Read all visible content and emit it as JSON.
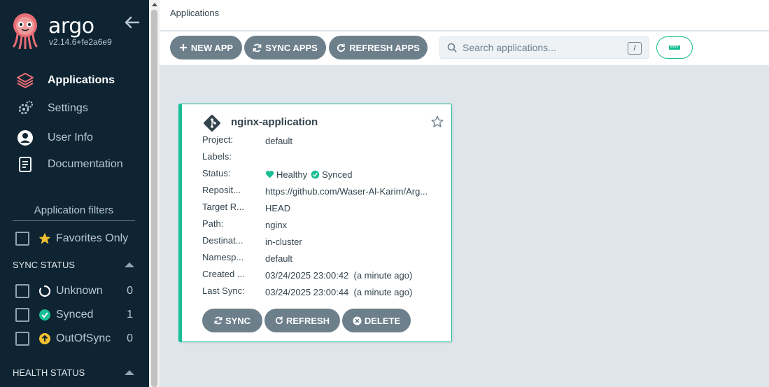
{
  "sidebar": {
    "logo_text": "argo",
    "version": "v2.14.6+fe2a6e9",
    "nav": [
      {
        "label": "Applications",
        "icon": "layers-icon",
        "active": true
      },
      {
        "label": "Settings",
        "icon": "gears-icon"
      },
      {
        "label": "User Info",
        "icon": "user-circle-icon"
      },
      {
        "label": "Documentation",
        "icon": "book-icon"
      }
    ],
    "filters_title": "Application filters",
    "favorites_label": "Favorites Only",
    "sync_status": {
      "title": "SYNC STATUS",
      "items": [
        {
          "label": "Unknown",
          "count": "0",
          "icon": "circle-notch-icon"
        },
        {
          "label": "Synced",
          "count": "1",
          "icon": "check-circle-icon"
        },
        {
          "label": "OutOfSync",
          "count": "0",
          "icon": "arrow-up-circle-icon"
        }
      ]
    },
    "health_status": {
      "title": "HEALTH STATUS"
    }
  },
  "header": {
    "breadcrumb": "Applications"
  },
  "toolbar": {
    "new_app": "NEW APP",
    "sync_apps": "SYNC APPS",
    "refresh_apps": "REFRESH APPS",
    "search_placeholder": "Search applications...",
    "search_shortcut": "/"
  },
  "colors": {
    "accent": "#18be94",
    "sidebar_bg": "#0e2432",
    "button_bg": "#6d7f8b",
    "argo_orange": "#e96d76"
  },
  "app_card": {
    "title": "nginx-application",
    "fields": [
      {
        "key": "Project:",
        "value": "default"
      },
      {
        "key": "Labels:",
        "value": ""
      },
      {
        "key": "Status:",
        "health": "Healthy",
        "sync": "Synced"
      },
      {
        "key": "Reposit...",
        "value": "https://github.com/Waser-Al-Karim/Arg..."
      },
      {
        "key": "Target R...",
        "value": "HEAD"
      },
      {
        "key": "Path:",
        "value": "nginx"
      },
      {
        "key": "Destinat...",
        "value": "in-cluster"
      },
      {
        "key": "Namesp...",
        "value": "default"
      },
      {
        "key": "Created ...",
        "value": "03/24/2025 23:00:42  (a minute ago)"
      },
      {
        "key": "Last Sync:",
        "value": "03/24/2025 23:00:44  (a minute ago)"
      }
    ],
    "buttons": {
      "sync": "SYNC",
      "refresh": "REFRESH",
      "delete": "DELETE"
    }
  }
}
